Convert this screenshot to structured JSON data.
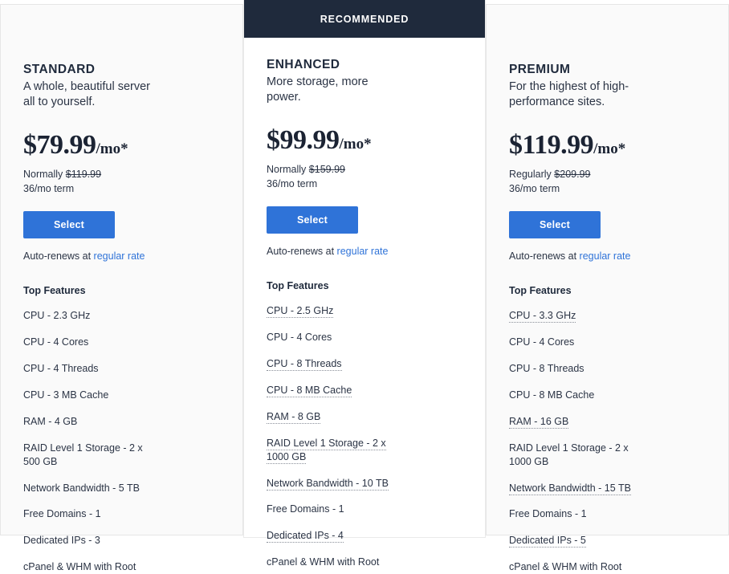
{
  "colors": {
    "accent_blue": "#2f73d8",
    "ribbon_navy": "#1f2a3c",
    "text_dark": "#1f2a3c",
    "side_card_bg": "#fafafa",
    "featured_card_bg": "#ffffff"
  },
  "ribbon": {
    "label": "RECOMMENDED"
  },
  "plans": [
    {
      "name": "STANDARD",
      "tagline": "A whole, beautiful server all to yourself.",
      "price_amount": "$79.99",
      "price_period": "/mo*",
      "normally_label": "Normally",
      "normally_price": "$119.99",
      "term": "36/mo term",
      "select_label": "Select",
      "renew_prefix": "Auto-renews at ",
      "renew_link": "regular rate",
      "features_title": "Top Features",
      "features": [
        {
          "text": "CPU - 2.3 GHz",
          "upgraded": false
        },
        {
          "text": "CPU - 4 Cores",
          "upgraded": false
        },
        {
          "text": "CPU - 4 Threads",
          "upgraded": false
        },
        {
          "text": "CPU - 3 MB Cache",
          "upgraded": false
        },
        {
          "text": "RAM - 4 GB",
          "upgraded": false
        },
        {
          "text": "RAID Level 1 Storage - 2 x 500 GB",
          "upgraded": false
        },
        {
          "text": "Network Bandwidth - 5 TB",
          "upgraded": false
        },
        {
          "text": "Free Domains - 1",
          "upgraded": false
        },
        {
          "text": "Dedicated IPs - 3",
          "upgraded": false
        },
        {
          "text": "cPanel & WHM with Root",
          "upgraded": false
        }
      ]
    },
    {
      "name": "ENHANCED",
      "tagline": "More storage, more power.",
      "price_amount": "$99.99",
      "price_period": "/mo*",
      "normally_label": "Normally",
      "normally_price": "$159.99",
      "term": "36/mo term",
      "select_label": "Select",
      "renew_prefix": "Auto-renews at ",
      "renew_link": "regular rate",
      "features_title": "Top Features",
      "features": [
        {
          "text": "CPU - 2.5 GHz",
          "upgraded": true
        },
        {
          "text": "CPU - 4 Cores",
          "upgraded": false
        },
        {
          "text": "CPU - 8 Threads",
          "upgraded": true
        },
        {
          "text": "CPU - 8 MB Cache",
          "upgraded": true
        },
        {
          "text": "RAM - 8 GB",
          "upgraded": true
        },
        {
          "text": "RAID Level 1 Storage - 2 x 1000 GB",
          "upgraded": true
        },
        {
          "text": "Network Bandwidth - 10 TB",
          "upgraded": true
        },
        {
          "text": "Free Domains - 1",
          "upgraded": false
        },
        {
          "text": "Dedicated IPs - 4",
          "upgraded": true
        },
        {
          "text": "cPanel & WHM with Root",
          "upgraded": false
        }
      ]
    },
    {
      "name": "PREMIUM",
      "tagline": "For the highest of high-performance sites.",
      "price_amount": "$119.99",
      "price_period": "/mo*",
      "normally_label": "Regularly",
      "normally_price": "$209.99",
      "term": "36/mo term",
      "select_label": "Select",
      "renew_prefix": "Auto-renews at ",
      "renew_link": "regular rate",
      "features_title": "Top Features",
      "features": [
        {
          "text": "CPU - 3.3 GHz",
          "upgraded": true
        },
        {
          "text": "CPU - 4 Cores",
          "upgraded": false
        },
        {
          "text": "CPU - 8 Threads",
          "upgraded": false
        },
        {
          "text": "CPU - 8 MB Cache",
          "upgraded": false
        },
        {
          "text": "RAM - 16 GB",
          "upgraded": true
        },
        {
          "text": "RAID Level 1 Storage - 2 x 1000 GB",
          "upgraded": false
        },
        {
          "text": "Network Bandwidth - 15 TB",
          "upgraded": true
        },
        {
          "text": "Free Domains - 1",
          "upgraded": false
        },
        {
          "text": "Dedicated IPs - 5",
          "upgraded": true
        },
        {
          "text": "cPanel & WHM with Root",
          "upgraded": false
        }
      ]
    }
  ]
}
